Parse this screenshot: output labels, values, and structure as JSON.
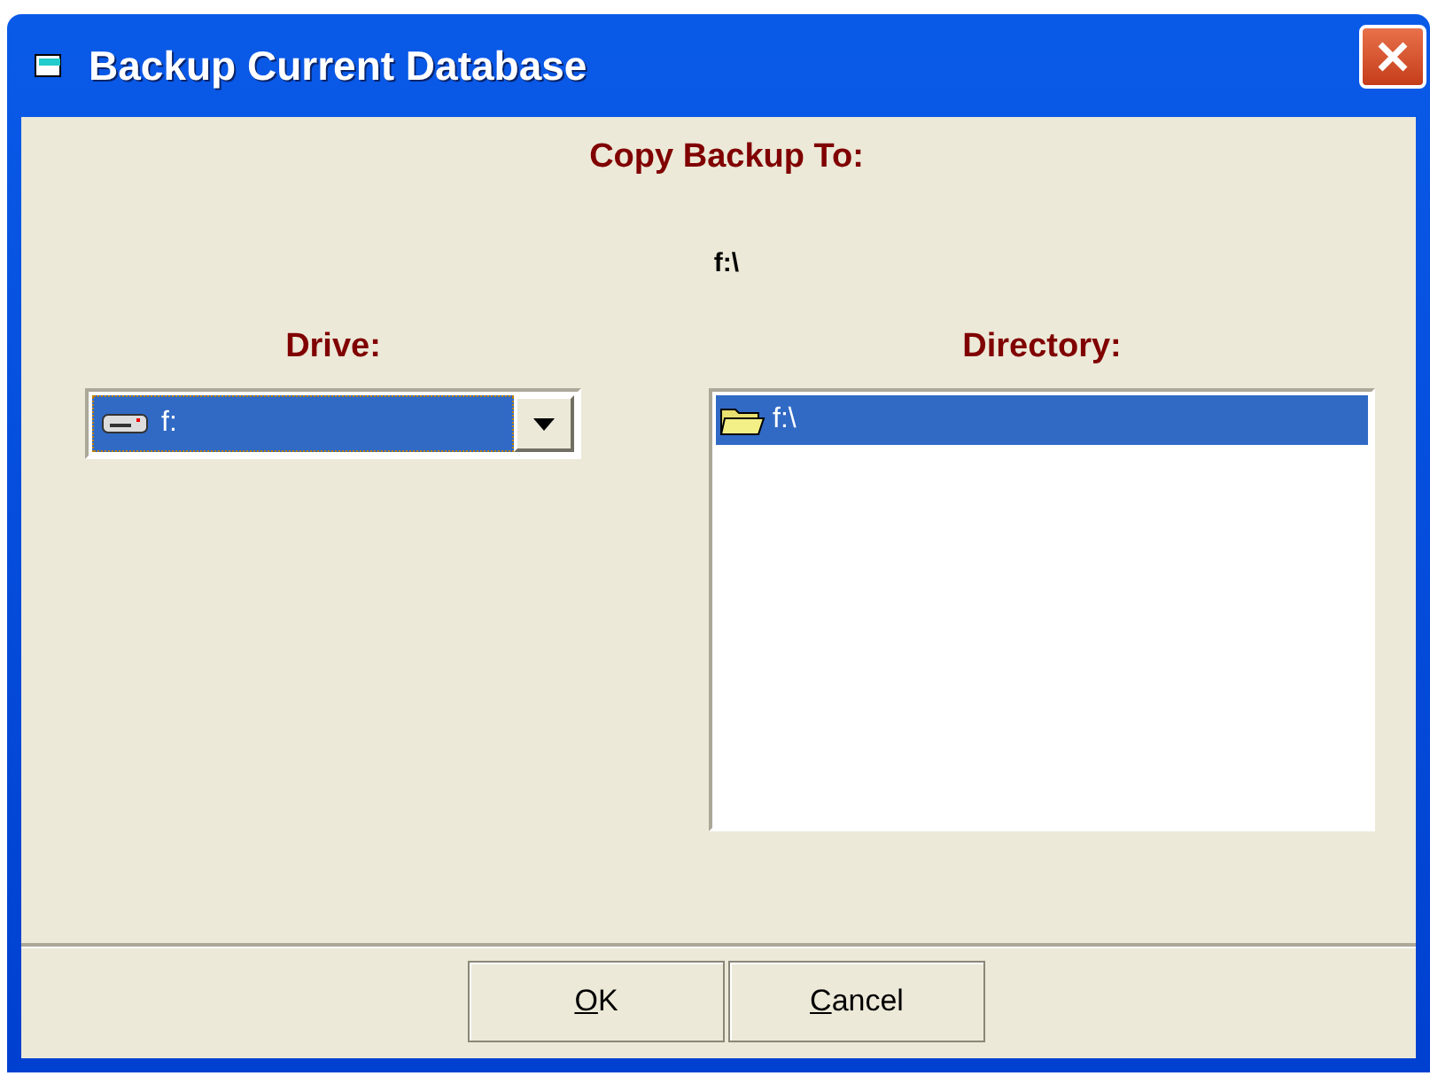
{
  "window": {
    "title": "Backup Current Database"
  },
  "destination": {
    "heading": "Copy Backup To:",
    "path": "f:\\"
  },
  "drive": {
    "label": "Drive:",
    "value": "f:",
    "selected": true
  },
  "directory": {
    "label": "Directory:",
    "items": [
      {
        "label": "f:\\",
        "selected": true
      }
    ]
  },
  "buttons": [
    {
      "label": "OK"
    },
    {
      "label": "Cancel"
    }
  ]
}
